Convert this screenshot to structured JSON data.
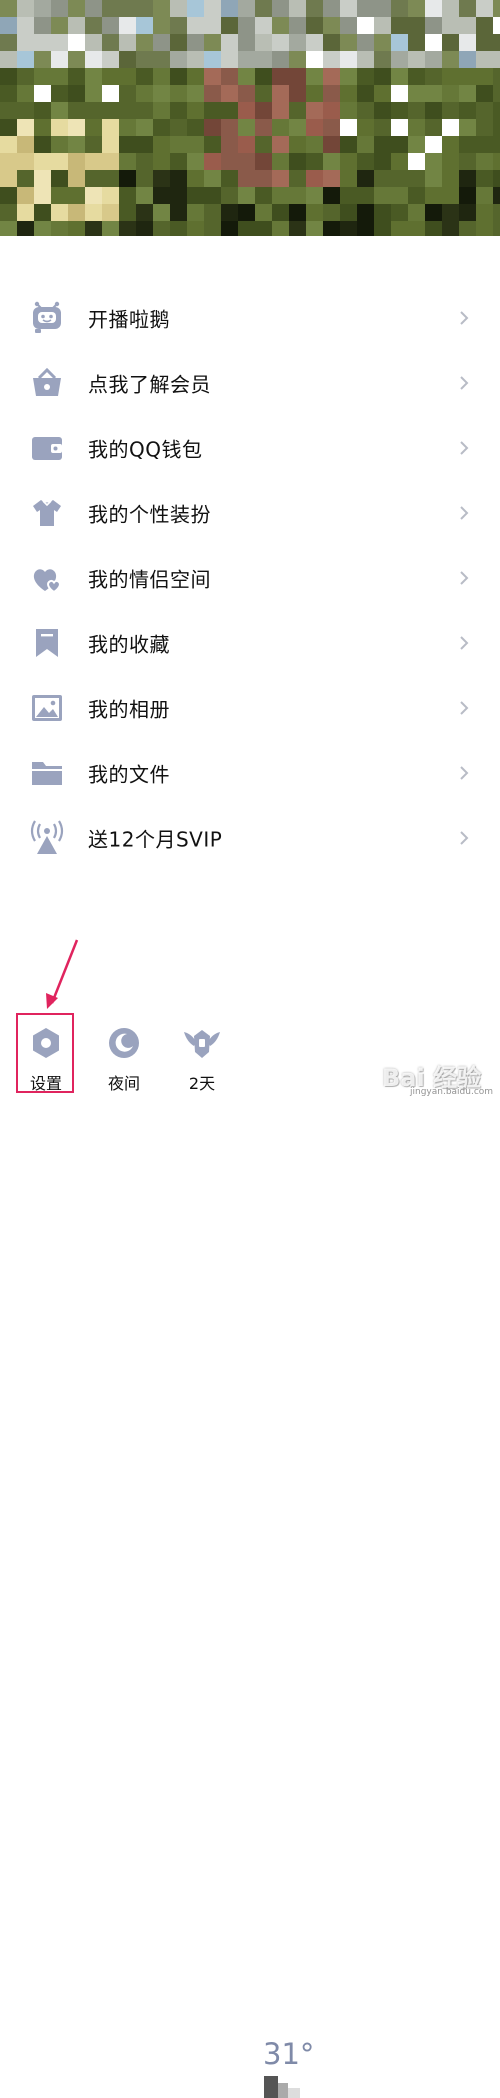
{
  "header": {
    "image": "pixelated-profile-background"
  },
  "menu": {
    "items": [
      {
        "label": "开播啦鹅",
        "icon": "robot-icon"
      },
      {
        "label": "点我了解会员",
        "icon": "vip-basket-icon"
      },
      {
        "label": "我的QQ钱包",
        "icon": "wallet-icon"
      },
      {
        "label": "我的个性装扮",
        "icon": "shirt-icon"
      },
      {
        "label": "我的情侣空间",
        "icon": "hearts-icon"
      },
      {
        "label": "我的收藏",
        "icon": "bookmark-icon"
      },
      {
        "label": "我的相册",
        "icon": "photo-icon"
      },
      {
        "label": "我的文件",
        "icon": "folder-icon"
      },
      {
        "label": "送12个月SVIP",
        "icon": "broadcast-icon"
      }
    ]
  },
  "bottom_bar": {
    "settings_label": "设置",
    "night_label": "夜间",
    "days_label": "2天",
    "temperature": "31°"
  },
  "watermark": {
    "text": "Bai 经验",
    "sub": "jingyan.baidu.com"
  },
  "colors": {
    "icon": "#9aa3be",
    "accent_red": "#e0245e",
    "text": "#111111"
  }
}
